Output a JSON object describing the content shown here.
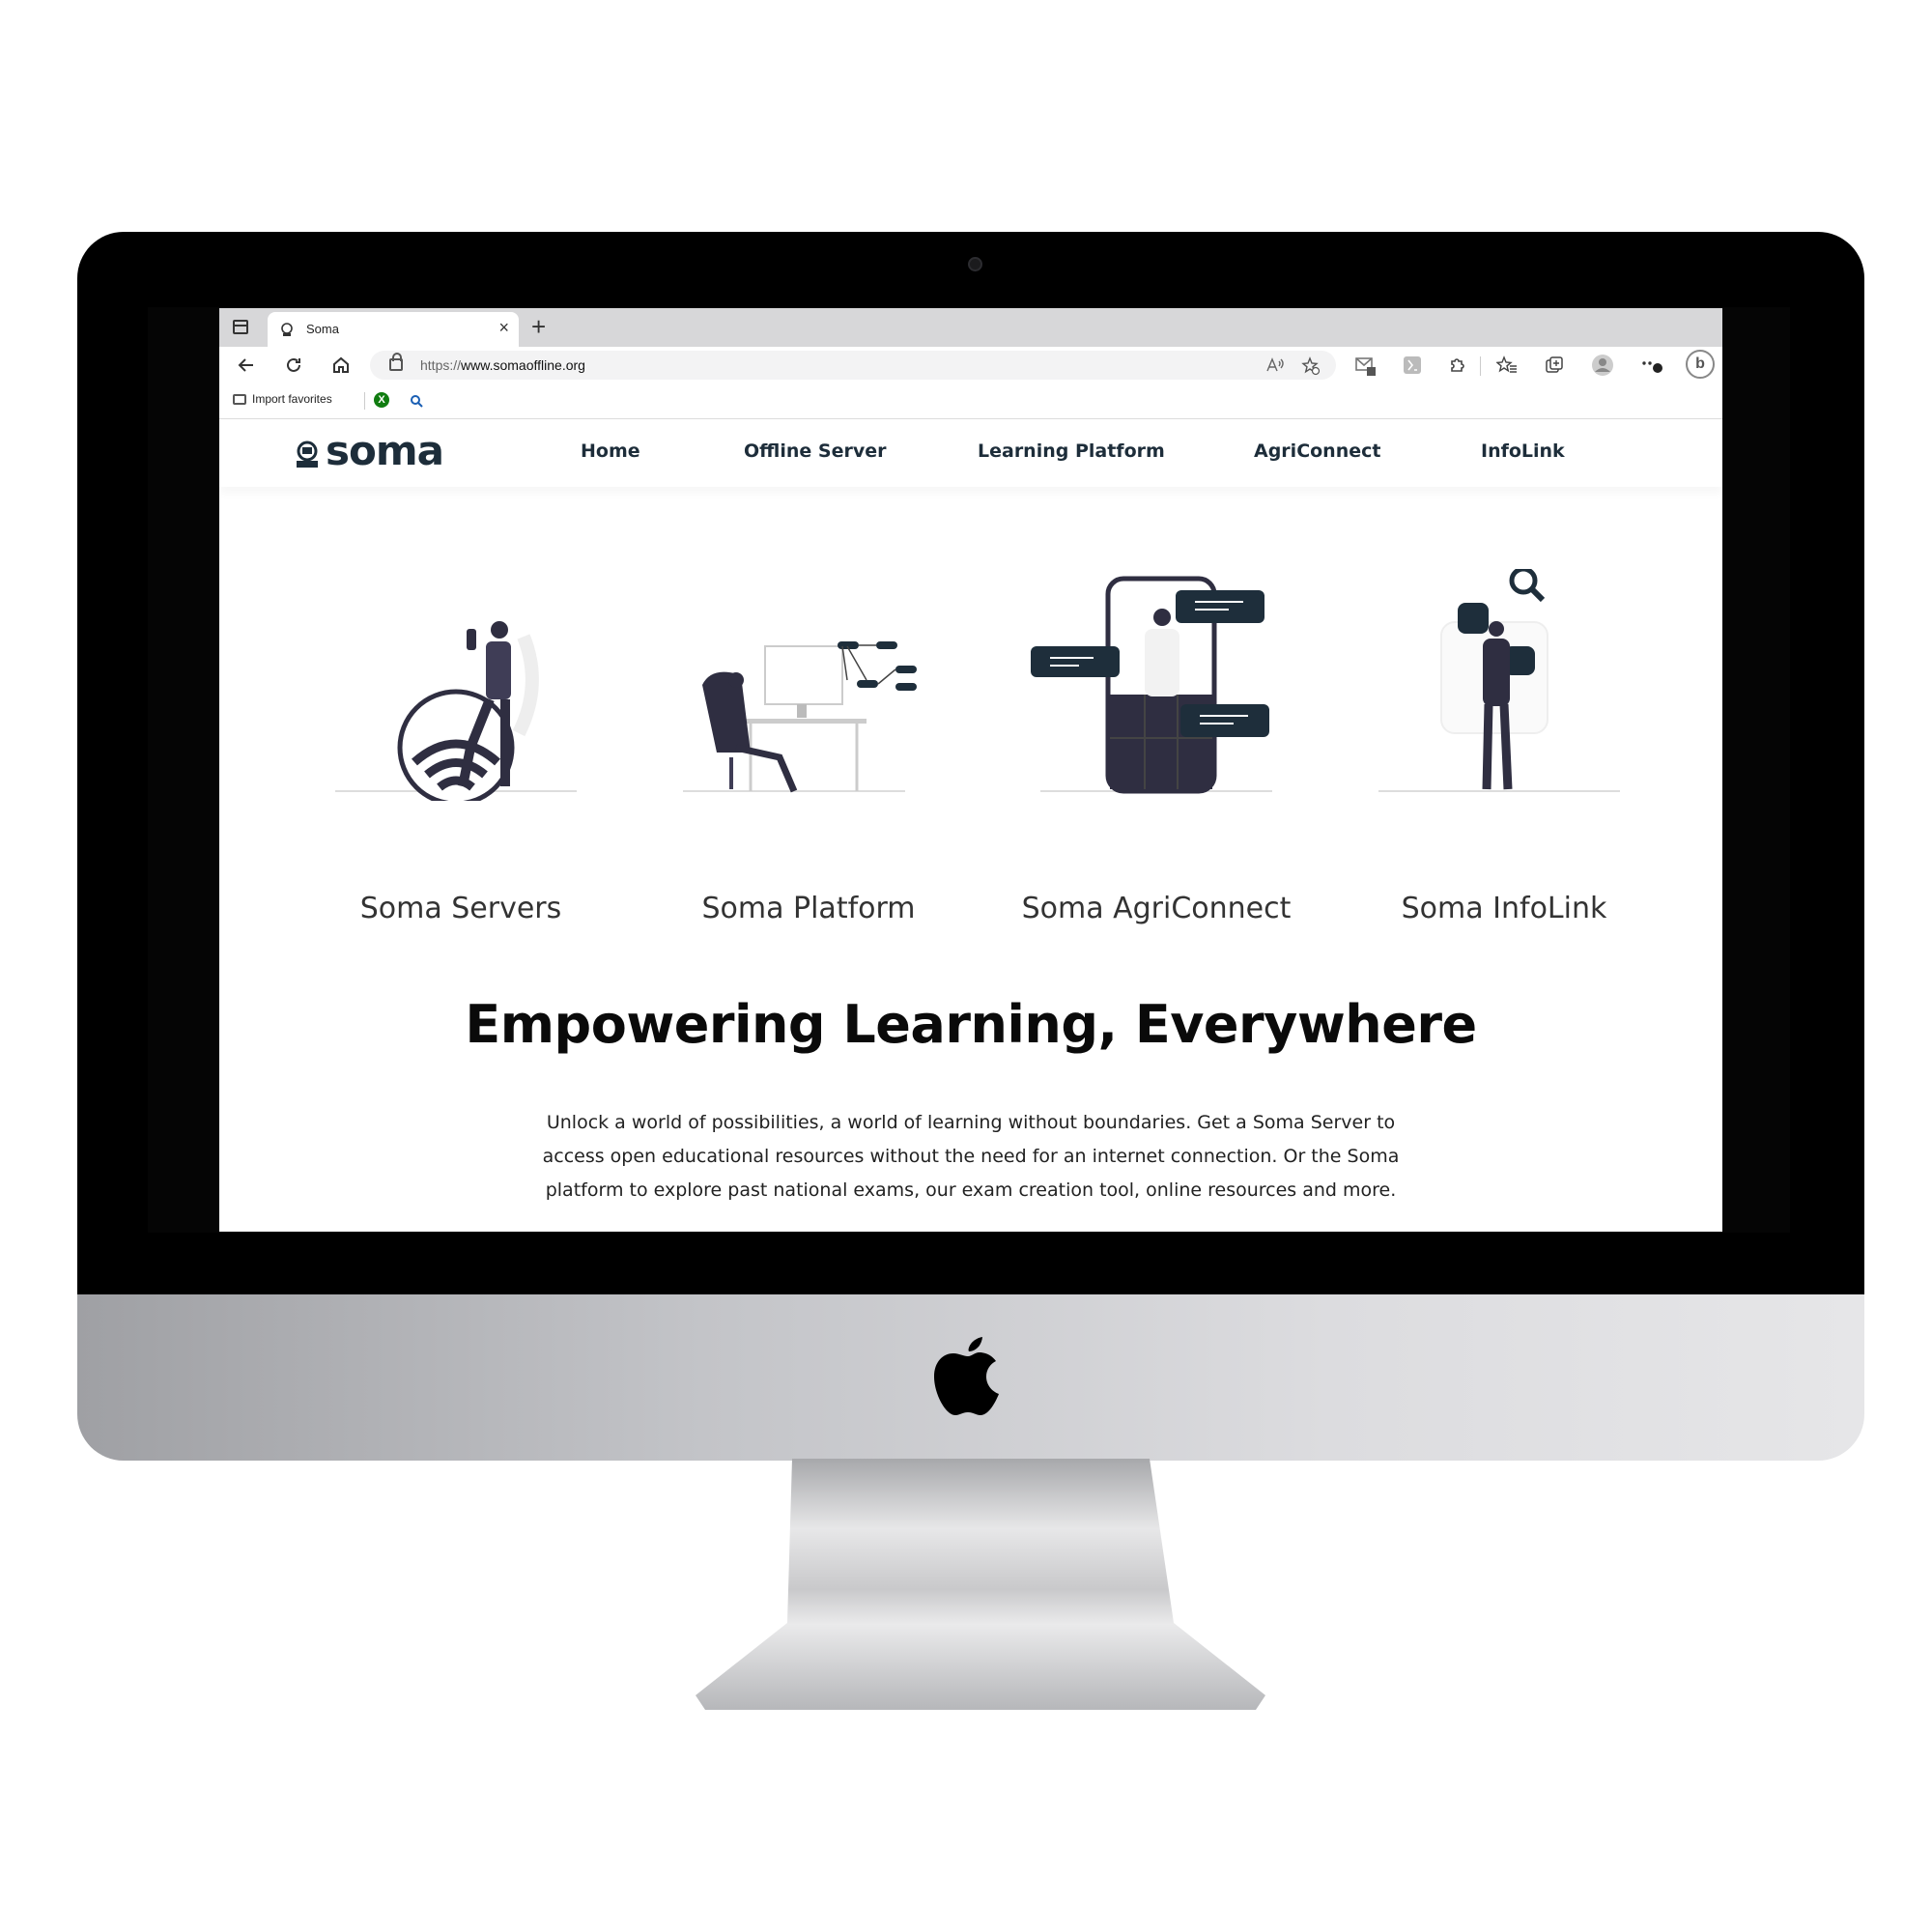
{
  "browser": {
    "tab_title": "Soma",
    "new_tab_label": "+",
    "close_label": "×",
    "url_protocol": "https://",
    "url_host": "www.somaoffline.org",
    "favorites": {
      "import_label": "Import favorites"
    }
  },
  "site": {
    "logo_text": "soma",
    "nav": [
      {
        "label": "Home"
      },
      {
        "label": "Offline Server"
      },
      {
        "label": "Learning Platform"
      },
      {
        "label": "AgriConnect"
      },
      {
        "label": "InfoLink"
      }
    ],
    "cards": [
      {
        "title": "Soma Servers"
      },
      {
        "title": "Soma Platform"
      },
      {
        "title": "Soma AgriConnect"
      },
      {
        "title": "Soma InfoLink"
      }
    ],
    "hero": {
      "title": "Empowering Learning, Everywhere",
      "text": "Unlock a world of possibilities, a world of learning without boundaries. Get a Soma Server to access open educational resources without the need for an internet connection. Or the Soma platform to explore past national exams, our exam creation tool, online resources and more."
    }
  },
  "colors": {
    "brand_dark": "#1d2d3a",
    "illustration": "#2f2e41",
    "accent": "#1e2e3b"
  },
  "icons": [
    "tab-actions-icon",
    "soma-favicon",
    "close-icon",
    "back-icon",
    "refresh-icon",
    "home-icon",
    "lock-icon",
    "read-aloud-icon",
    "add-favorite-icon",
    "mail-extension-icon",
    "extension-icon",
    "puzzle-icon",
    "favorites-icon",
    "collections-icon",
    "profile-icon",
    "more-icon",
    "bing-icon",
    "folder-icon",
    "xbox-icon",
    "search-icon",
    "apple-logo-icon"
  ]
}
